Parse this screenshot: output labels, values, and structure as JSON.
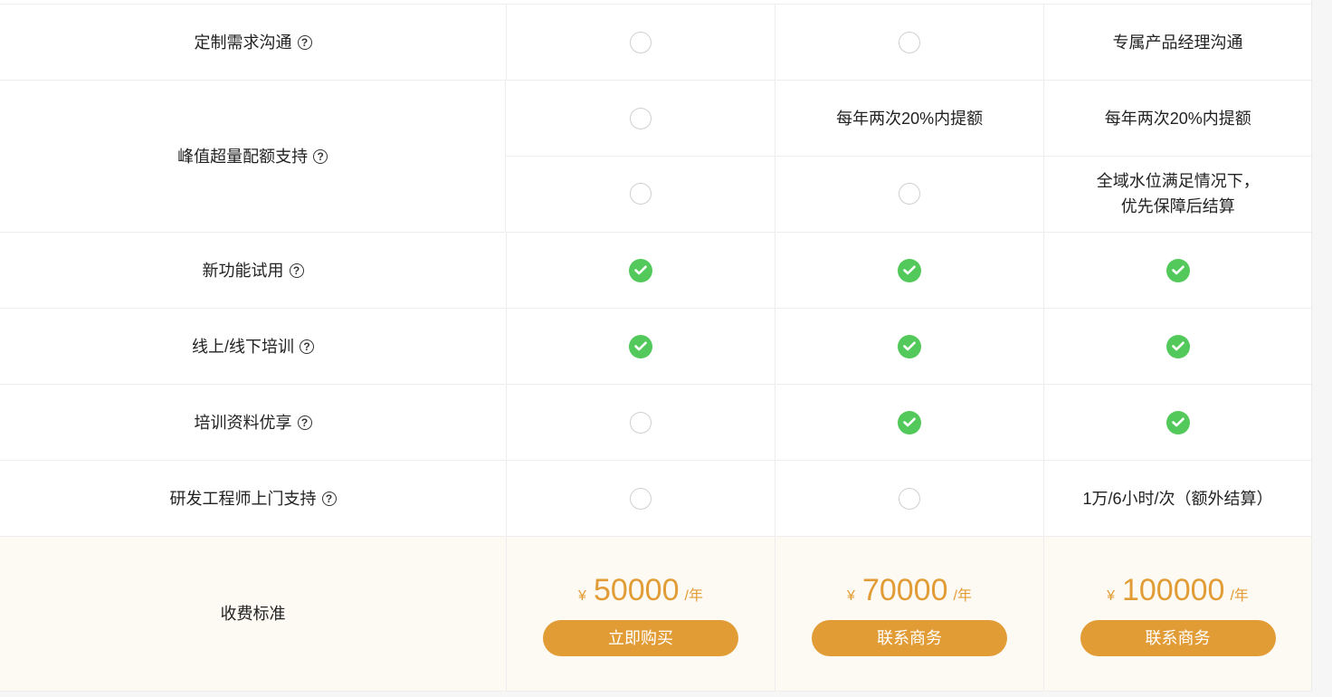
{
  "rows": [
    {
      "label": "定制需求沟通",
      "cols": [
        "",
        "",
        "专属产品经理沟通"
      ]
    },
    {
      "label": "峰值超量配额支持",
      "sub": [
        [
          "",
          "每年两次20%内提额",
          "每年两次20%内提额"
        ],
        [
          "",
          "",
          "全域水位满足情况下，\n优先保障后结算"
        ]
      ]
    },
    {
      "label": "新功能试用"
    },
    {
      "label": "线上/线下培训"
    },
    {
      "label": "培训资料优享"
    },
    {
      "label": "研发工程师上门支持",
      "cols": [
        "",
        "",
        "1万/6小时/次（额外结算）"
      ]
    }
  ],
  "question_mark": "?",
  "pricing": {
    "label": "收费标准",
    "currency": "¥",
    "per": "/年",
    "plans": [
      {
        "amount": "50000",
        "button": "立即购买"
      },
      {
        "amount": "70000",
        "button": "联系商务"
      },
      {
        "amount": "100000",
        "button": "联系商务"
      }
    ]
  },
  "icons": {
    "empty": "empty-circle-icon",
    "check": "check-circle-icon",
    "help": "question-circle-icon"
  },
  "colors": {
    "accent": "#e29c36",
    "check": "#52c95a"
  }
}
